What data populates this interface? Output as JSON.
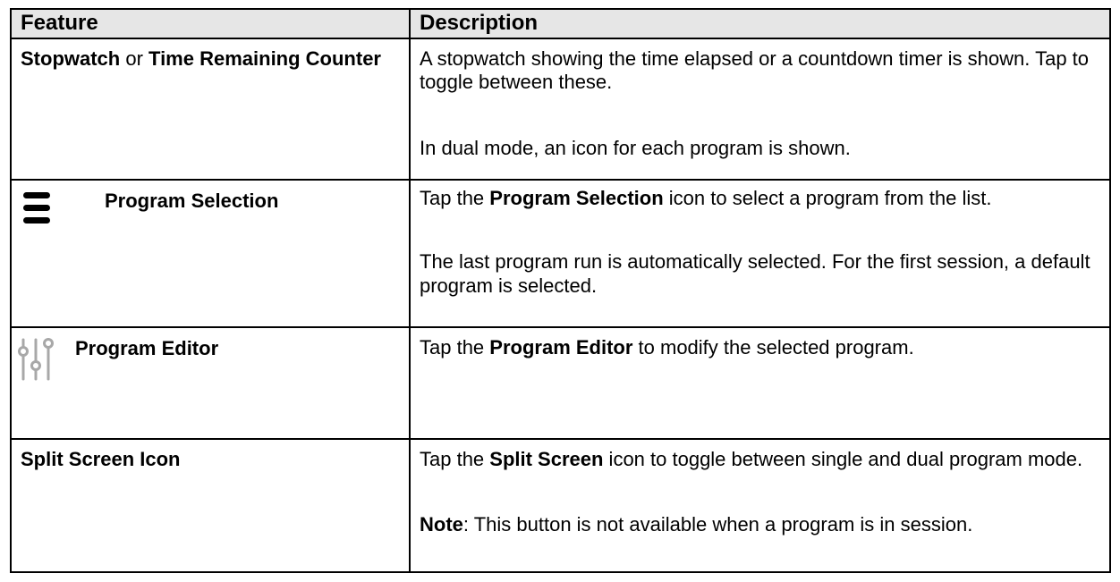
{
  "table": {
    "headers": {
      "feature": "Feature",
      "description": "Description"
    },
    "rows": [
      {
        "feature": {
          "part1": "Stopwatch",
          "connector": " or ",
          "part2": "Time Remaining Counter"
        },
        "description": {
          "p1": "A stopwatch showing the time elapsed or a countdown timer is shown. Tap to toggle between these.",
          "p2": "In dual mode, an icon for each program is shown."
        }
      },
      {
        "feature": {
          "icon": "menu-icon",
          "label": "Program Selection"
        },
        "description": {
          "p1_pre": "Tap the ",
          "p1_bold": "Program Selection",
          "p1_post": " icon to select a program from the list.",
          "p2": "The last program run is automatically selected. For the first session, a default program is selected."
        }
      },
      {
        "feature": {
          "icon": "sliders-icon",
          "label": "Program Editor"
        },
        "description": {
          "p1_pre": "Tap the ",
          "p1_bold": "Program Editor",
          "p1_post": " to modify the selected program."
        }
      },
      {
        "feature": {
          "label": "Split Screen Icon"
        },
        "description": {
          "p1_pre": "Tap the ",
          "p1_bold": "Split Screen",
          "p1_post": " icon to toggle between single and dual program mode.",
          "p2_bold": "Note",
          "p2_post": ": This button is not available when a program is in session."
        }
      }
    ]
  },
  "colors": {
    "header_background": "#e6e6e6",
    "border": "#000000",
    "icon_gray": "#a8a8a8"
  }
}
